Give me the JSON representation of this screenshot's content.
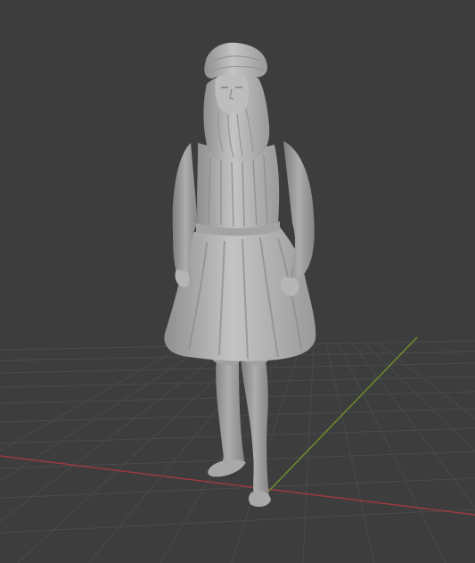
{
  "viewport": {
    "background": "#3d3d3d",
    "floor_grid_color": "#4a4a4a",
    "x_axis_color": "#9b3a3f",
    "y_axis_color": "#6b8e2e"
  },
  "scene_object": {
    "kind": "sculpted figure (bearded man statue)",
    "material_color": "#b3b3b3"
  }
}
